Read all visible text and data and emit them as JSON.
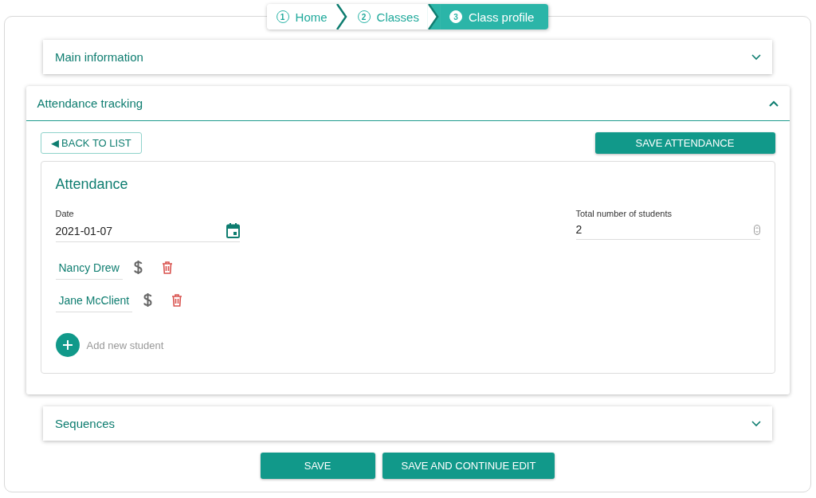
{
  "breadcrumb": [
    {
      "number": "1",
      "label": "Home",
      "selected": false
    },
    {
      "number": "2",
      "label": "Classes",
      "selected": false
    },
    {
      "number": "3",
      "label": "Class profile",
      "selected": true
    }
  ],
  "panels": [
    {
      "title": "Main information",
      "expanded": false
    },
    {
      "title": "Attendance tracking",
      "expanded": true,
      "body": {
        "back_button": "◀ BACK TO LIST",
        "save_button": "SAVE ATTENDANCE",
        "heading": "Attendance",
        "date": {
          "label": "Date",
          "value": "2021-01-07"
        },
        "total": {
          "label": "Total number of students",
          "value": "2"
        },
        "students": [
          {
            "name": "Nancy Drew"
          },
          {
            "name": "Jane McClient"
          }
        ],
        "add_student": "Add new student"
      }
    },
    {
      "title": "Sequences",
      "expanded": false
    }
  ],
  "footer_buttons": [
    "SAVE",
    "SAVE AND CONTINUE EDIT"
  ]
}
